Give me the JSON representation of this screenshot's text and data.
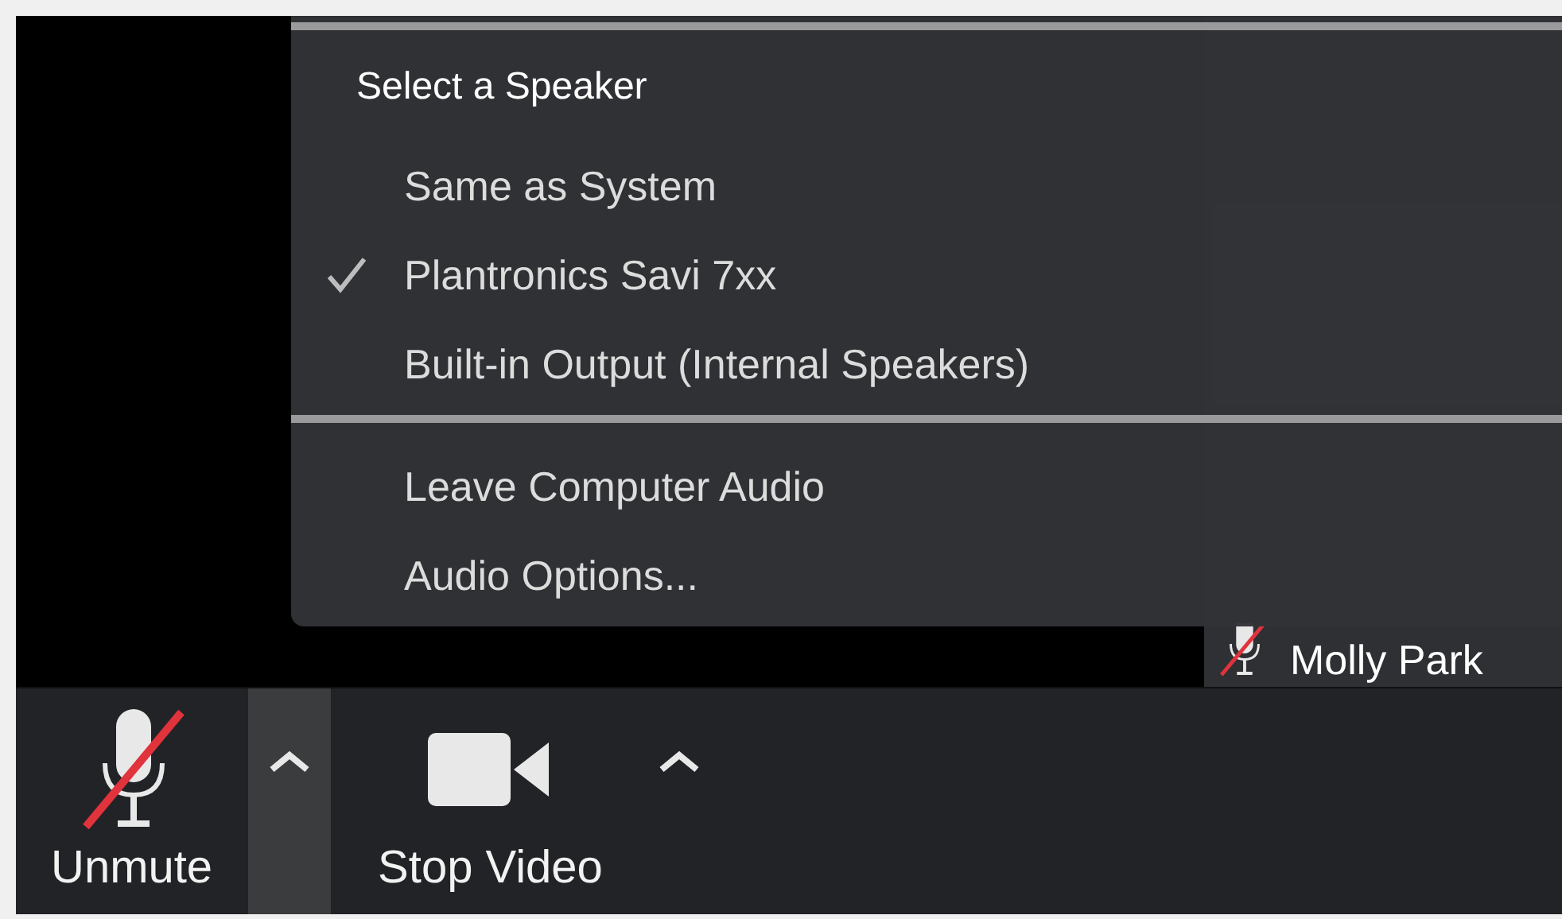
{
  "participant": {
    "name": "Molly Park",
    "muted": true
  },
  "menu": {
    "header": "Select a Speaker",
    "items": [
      {
        "label": "Same as System",
        "selected": false
      },
      {
        "label": "Plantronics Savi 7xx",
        "selected": true
      },
      {
        "label": "Built-in Output (Internal Speakers)",
        "selected": false
      }
    ],
    "actions": [
      "Leave Computer Audio",
      "Audio Options..."
    ]
  },
  "toolbar": [
    {
      "kind": "mic",
      "label": "Unmute",
      "muted": true
    },
    {
      "kind": "caret",
      "expanded": true
    },
    {
      "kind": "video",
      "label": "Stop Video"
    },
    {
      "kind": "caret",
      "expanded": false
    }
  ]
}
